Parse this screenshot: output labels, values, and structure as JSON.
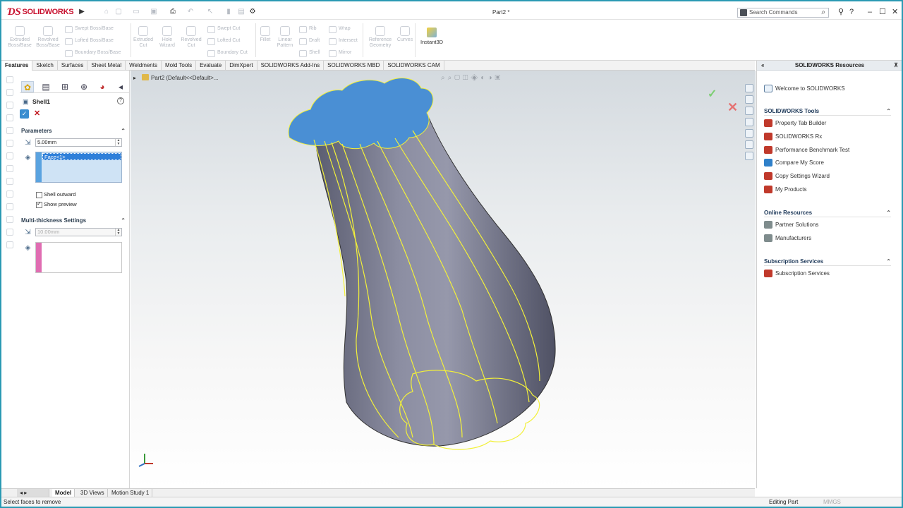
{
  "titlebar": {
    "app": "SOLIDWORKS",
    "doc_title": "Part2 *",
    "search_placeholder": "Search Commands"
  },
  "command_manager": {
    "big": [
      {
        "label": "Extruded\nBoss/Base"
      },
      {
        "label": "Revolved\nBoss/Base"
      },
      {
        "label": "Extruded\nCut"
      },
      {
        "label": "Hole\nWizard"
      },
      {
        "label": "Revolved\nCut"
      },
      {
        "label": "Fillet"
      },
      {
        "label": "Linear\nPattern"
      },
      {
        "label": "Reference\nGeometry"
      },
      {
        "label": "Curves"
      }
    ],
    "small": [
      "Swept Boss/Base",
      "Lofted Boss/Base",
      "Boundary Boss/Base",
      "Swept Cut",
      "Lofted Cut",
      "Boundary Cut",
      "Rib",
      "Draft",
      "Shell",
      "Wrap",
      "Intersect",
      "Mirror"
    ],
    "instant3d": "Instant3D"
  },
  "tabs": [
    "Features",
    "Sketch",
    "Surfaces",
    "Sheet Metal",
    "Weldments",
    "Mold Tools",
    "Evaluate",
    "DimXpert",
    "SOLIDWORKS Add-Ins",
    "SOLIDWORKS MBD",
    "SOLIDWORKS CAM"
  ],
  "property_manager": {
    "title": "Shell1",
    "parameters_label": "Parameters",
    "thickness": "5.00mm",
    "faces": [
      "Face<1>"
    ],
    "shell_outward": "Shell outward",
    "show_preview": "Show preview",
    "multi_label": "Multi-thickness Settings",
    "multi_thickness": "10.00mm"
  },
  "viewport": {
    "tree_label": "Part2  (Default<<Default>..."
  },
  "resources": {
    "title": "SOLIDWORKS Resources",
    "welcome": "Welcome to SOLIDWORKS",
    "tools_header": "SOLIDWORKS Tools",
    "tools": [
      "Property Tab Builder",
      "SOLIDWORKS Rx",
      "Performance Benchmark Test",
      "Compare My Score",
      "Copy Settings Wizard",
      "My Products"
    ],
    "online_header": "Online Resources",
    "online": [
      "Partner Solutions",
      "Manufacturers"
    ],
    "subs_header": "Subscription Services",
    "subs": [
      "Subscription Services"
    ]
  },
  "bottom_tabs": [
    "Model",
    "3D Views",
    "Motion Study 1"
  ],
  "status": {
    "message": "Select faces to remove",
    "mode": "Editing Part",
    "units": "MMGS"
  },
  "colors": {
    "accent": "#2f7fd9",
    "selected_face": "#4a8fd4",
    "edges": "#f2f03a",
    "body": "#7d7f92"
  }
}
